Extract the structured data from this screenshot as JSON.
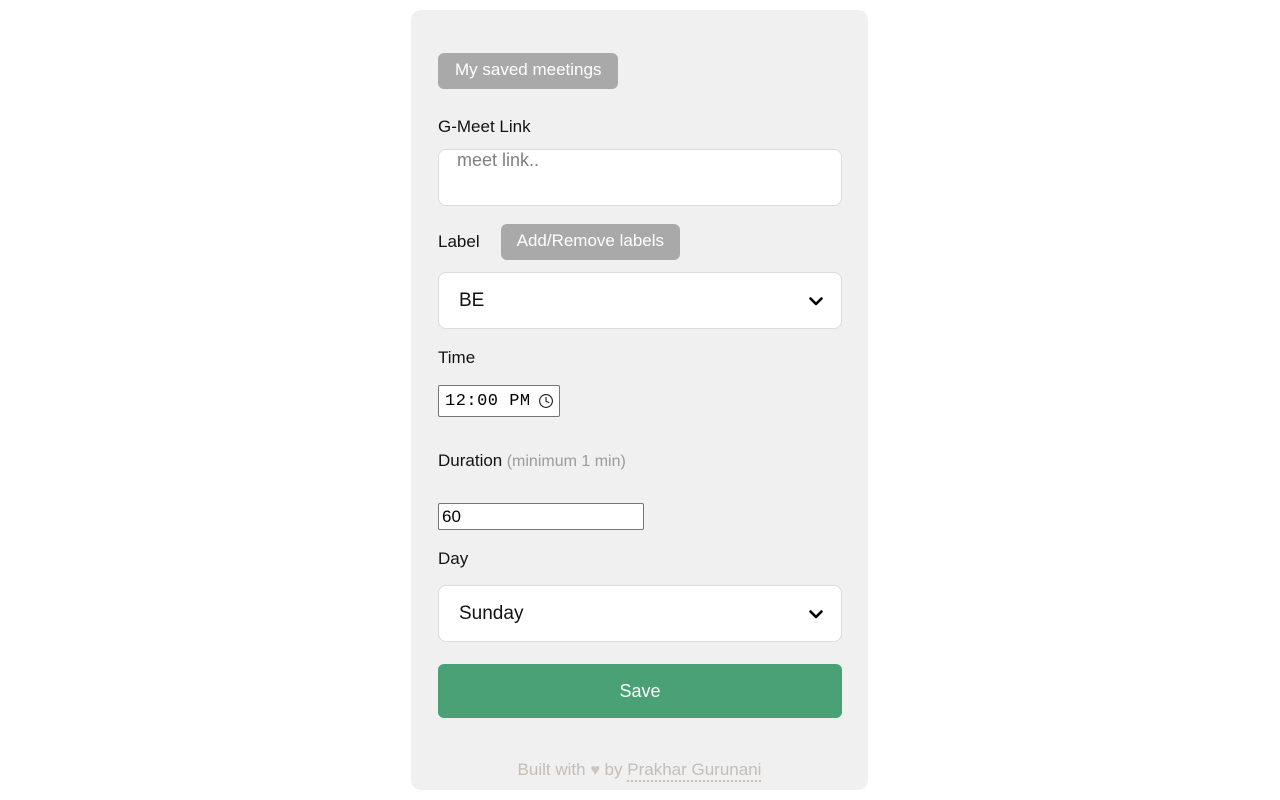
{
  "page": {
    "background_color": "#ffffff",
    "card_color": "#f0f0f0"
  },
  "toolbar": {
    "saved_meetings_label": "My saved meetings"
  },
  "form": {
    "gmeet": {
      "label": "G-Meet Link",
      "placeholder": "meet link..",
      "value": ""
    },
    "label_field": {
      "label": "Label",
      "manage_button_label": "Add/Remove labels",
      "selected": "BE",
      "chevron_icon": "chevron-down-icon"
    },
    "time": {
      "label": "Time",
      "value": "12:00 PM",
      "icon": "clock-icon"
    },
    "duration": {
      "label": "Duration",
      "hint": "(minimum 1 min)",
      "value": "60"
    },
    "day": {
      "label": "Day",
      "selected": "Sunday",
      "chevron_icon": "chevron-down-icon"
    },
    "save": {
      "label": "Save",
      "color": "#4aa176"
    }
  },
  "footer": {
    "prefix": "Built with",
    "heart_icon": "heart-icon",
    "heart_glyph": "♥",
    "middle": "by",
    "author": "Prakhar Gurunani",
    "color": "#c6bdb5"
  }
}
